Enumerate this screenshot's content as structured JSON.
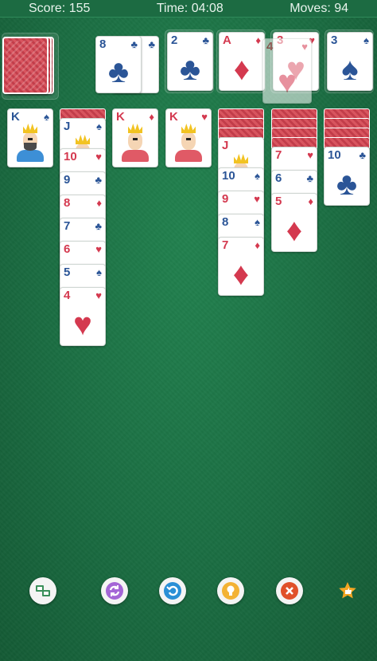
{
  "status": {
    "score_label": "Score: 155",
    "time_label": "Time: 04:08",
    "moves_label": "Moves: 94"
  },
  "stock": {
    "back_color": "#c9404c"
  },
  "waste": [
    {
      "rank": "8",
      "suit": "clubs",
      "color": "blue"
    }
  ],
  "foundations": [
    {
      "rank": "2",
      "suit": "clubs",
      "color": "blue"
    },
    {
      "rank": "A",
      "suit": "diamonds",
      "color": "red"
    },
    {
      "rank": "3",
      "suit": "hearts",
      "color": "red",
      "faded": true,
      "dragging_rank": "4"
    },
    {
      "rank": "3",
      "suit": "spades",
      "color": "blue"
    }
  ],
  "tableau": [
    {
      "hidden": 0,
      "cards": [
        {
          "rank": "K",
          "suit": "spades",
          "color": "blue",
          "face": true
        }
      ]
    },
    {
      "hidden": 1,
      "cards": [
        {
          "rank": "J",
          "suit": "spades",
          "color": "blue",
          "face": true
        },
        {
          "rank": "10",
          "suit": "hearts",
          "color": "red"
        },
        {
          "rank": "9",
          "suit": "clubs",
          "color": "blue"
        },
        {
          "rank": "8",
          "suit": "diamonds",
          "color": "red"
        },
        {
          "rank": "7",
          "suit": "clubs",
          "color": "blue"
        },
        {
          "rank": "6",
          "suit": "hearts",
          "color": "red"
        },
        {
          "rank": "5",
          "suit": "spades",
          "color": "blue"
        },
        {
          "rank": "4",
          "suit": "hearts",
          "color": "red"
        }
      ]
    },
    {
      "hidden": 0,
      "cards": [
        {
          "rank": "K",
          "suit": "diamonds",
          "color": "red",
          "face": true
        }
      ]
    },
    {
      "hidden": 0,
      "cards": [
        {
          "rank": "K",
          "suit": "hearts",
          "color": "red",
          "face": true
        }
      ]
    },
    {
      "hidden": 3,
      "cards": [
        {
          "rank": "J",
          "suit": "",
          "color": "red",
          "face": true
        },
        {
          "rank": "10",
          "suit": "spades",
          "color": "blue"
        },
        {
          "rank": "9",
          "suit": "hearts",
          "color": "red"
        },
        {
          "rank": "8",
          "suit": "spades",
          "color": "blue"
        },
        {
          "rank": "7",
          "suit": "diamonds",
          "color": "red"
        }
      ]
    },
    {
      "hidden": 4,
      "cards": [
        {
          "rank": "7",
          "suit": "hearts",
          "color": "red"
        },
        {
          "rank": "6",
          "suit": "clubs",
          "color": "blue"
        },
        {
          "rank": "5",
          "suit": "diamonds",
          "color": "red"
        }
      ]
    },
    {
      "hidden": 4,
      "cards": [
        {
          "rank": "10",
          "suit": "clubs",
          "color": "blue"
        }
      ]
    }
  ],
  "toolbar": [
    {
      "name": "themes-button",
      "icon": "cards-icon",
      "color": "#3a8f5a"
    },
    {
      "name": "new-game-button",
      "icon": "refresh-icon",
      "color": "#8a3ec2"
    },
    {
      "name": "undo-button",
      "icon": "undo-icon",
      "color": "#2a8fd6"
    },
    {
      "name": "hint-button",
      "icon": "lightbulb-icon",
      "color": "#f0a323"
    },
    {
      "name": "close-button",
      "icon": "close-icon",
      "color": "#e0502a"
    },
    {
      "name": "rate-button",
      "icon": "star-icon",
      "color": "#f5a623"
    }
  ]
}
